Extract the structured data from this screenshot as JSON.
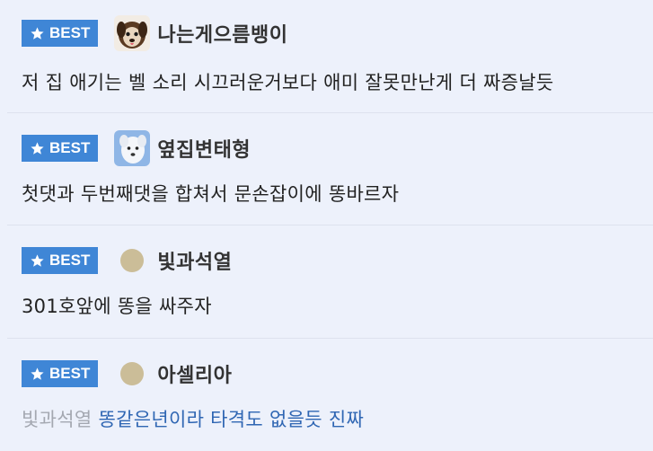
{
  "badge_label": "BEST",
  "colors": {
    "badge": "#3f86d6",
    "mention": "#a4a8b1",
    "reply_text": "#2f66b3",
    "background": "#edf1fb"
  },
  "comments": [
    {
      "author": "나는게으름뱅이",
      "avatar": "dog-avatar",
      "text": "저 집 애기는 벨 소리 시끄러운거보다 애미 잘못만난게 더 짜증날듯"
    },
    {
      "author": "옆집변태형",
      "avatar": "white-dog-avatar",
      "text": "첫댓과 두번째댓을 합쳐서 문손잡이에 똥바르자"
    },
    {
      "author": "빛과석열",
      "avatar": "default-avatar",
      "text": "301호앞에 똥을 싸주자"
    },
    {
      "author": "아셀리아",
      "avatar": "default-avatar",
      "mention": "빛과석열",
      "text": "똥같은년이라 타격도 없을듯 진짜"
    }
  ]
}
